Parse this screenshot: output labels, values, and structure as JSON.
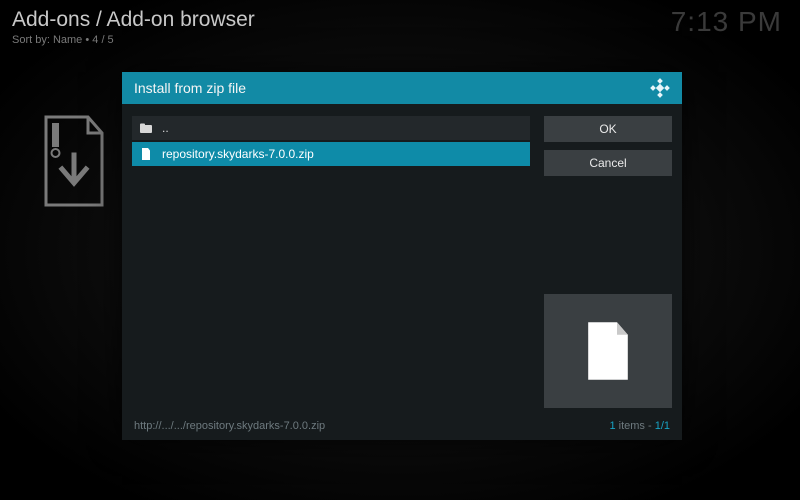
{
  "header": {
    "breadcrumb": "Add-ons / Add-on browser",
    "sortby": "Sort by: Name  •  4 / 5",
    "clock": "7:13 PM"
  },
  "dialog": {
    "title": "Install from zip file",
    "updir_label": "..",
    "selected_file": "repository.skydarks-7.0.0.zip",
    "buttons": {
      "ok": "OK",
      "cancel": "Cancel"
    },
    "footer": {
      "path": "http://.../.../repository.skydarks-7.0.0.zip",
      "count_num": "1",
      "count_word": " items - ",
      "page": "1/1"
    }
  }
}
